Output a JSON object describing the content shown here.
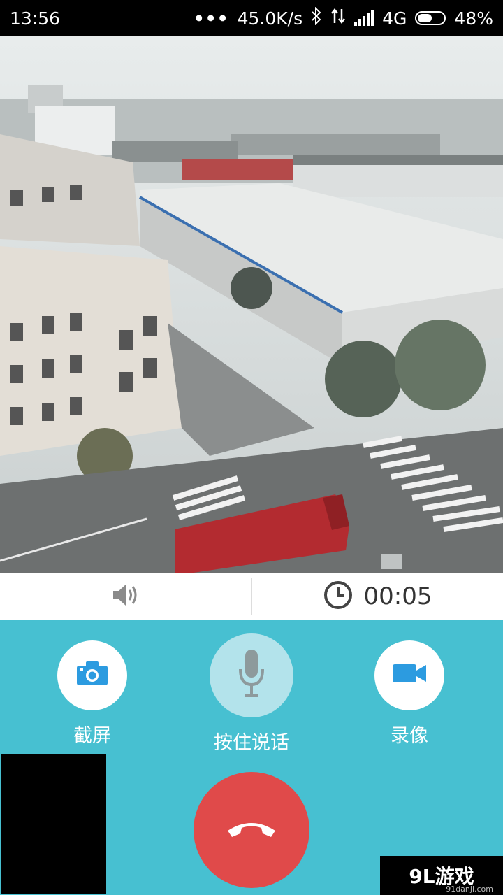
{
  "status_bar": {
    "time": "13:56",
    "dots": "•••",
    "speed": "45.0K/s",
    "bluetooth_icon": "bluetooth-icon",
    "data_icon": "data-transfer-icon",
    "network": "4G",
    "battery": "48%"
  },
  "info_bar": {
    "speaker_icon": "speaker-icon",
    "clock_icon": "clock-icon",
    "duration": "00:05"
  },
  "controls": {
    "screenshot_label": "截屏",
    "push_to_talk_label": "按住说话",
    "record_label": "录像",
    "hangup_icon": "phone-hangup-icon"
  },
  "watermark": {
    "text": "9L游戏",
    "sub": "91danji.com"
  },
  "colors": {
    "panel_bg": "#47c0d1",
    "hangup": "#e04a4a",
    "icon_blue": "#2c9be0"
  }
}
